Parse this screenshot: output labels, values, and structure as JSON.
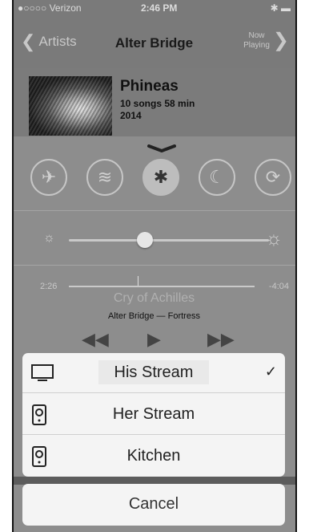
{
  "status_bar": {
    "carrier": "●○○○○ Verizon",
    "time": "2:46 PM",
    "battery": "✱ ▬"
  },
  "nav": {
    "back_label": "Artists",
    "title": "Alter Bridge",
    "now_playing_line1": "Now",
    "now_playing_line2": "Playing"
  },
  "album": {
    "title": "Phineas",
    "meta": "10 songs 58 min",
    "year": "2014"
  },
  "control_center": {
    "toggles": [
      {
        "name": "airplane-mode",
        "icon": "airplane-icon",
        "glyph": "✈",
        "active": false
      },
      {
        "name": "wifi",
        "icon": "wifi-icon",
        "glyph": "≋",
        "active": false
      },
      {
        "name": "bluetooth",
        "icon": "bluetooth-icon",
        "glyph": "✱",
        "active": true
      },
      {
        "name": "do-not-disturb",
        "icon": "moon-icon",
        "glyph": "☾",
        "active": false
      },
      {
        "name": "rotation-lock",
        "icon": "rotation-lock-icon",
        "glyph": "⟳",
        "active": false
      }
    ],
    "brightness": 0.38,
    "playback": {
      "elapsed": "2:26",
      "remaining": "-4:04",
      "progress": 0.37,
      "song": "Cry of Achilles",
      "artist_album": "Alter Bridge — Fortress"
    }
  },
  "airplay_sheet": {
    "options": [
      {
        "label": "His Stream",
        "icon": "tv-icon",
        "selected": true
      },
      {
        "label": "Her Stream",
        "icon": "speaker-icon",
        "selected": false
      },
      {
        "label": "Kitchen",
        "icon": "speaker-icon",
        "selected": false
      }
    ],
    "checkmark": "✓",
    "cancel_label": "Cancel"
  }
}
